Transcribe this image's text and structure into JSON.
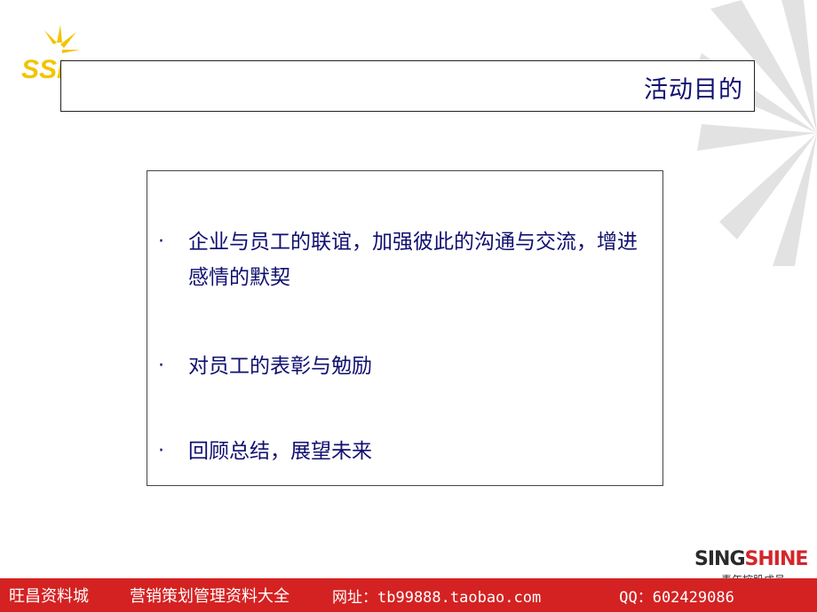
{
  "slide": {
    "title": "活动目的",
    "bullet_symbol": "·",
    "bullets": [
      "企业与员工的联谊，加强彼此的沟通与交流，增进感情的默契",
      "对员工的表彰与勉励",
      "回顾总结，展望未来"
    ]
  },
  "logos": {
    "top_left_text": "SSI",
    "bottom_right_word_a": "SING",
    "bottom_right_word_b": "SHINE",
    "bottom_right_sub": "青年控股成员"
  },
  "footer": {
    "site_name": "旺昌资料城",
    "slogan": "营销策划管理资料大全",
    "url_text": "网址：tb99888.taobao.com",
    "qq_text": "QQ：602429086"
  },
  "colors": {
    "text_navy": "#101070",
    "footer_red": "#d42222",
    "burst_gray": "#dcdcdc",
    "logo_yellow": "#f2c400"
  }
}
